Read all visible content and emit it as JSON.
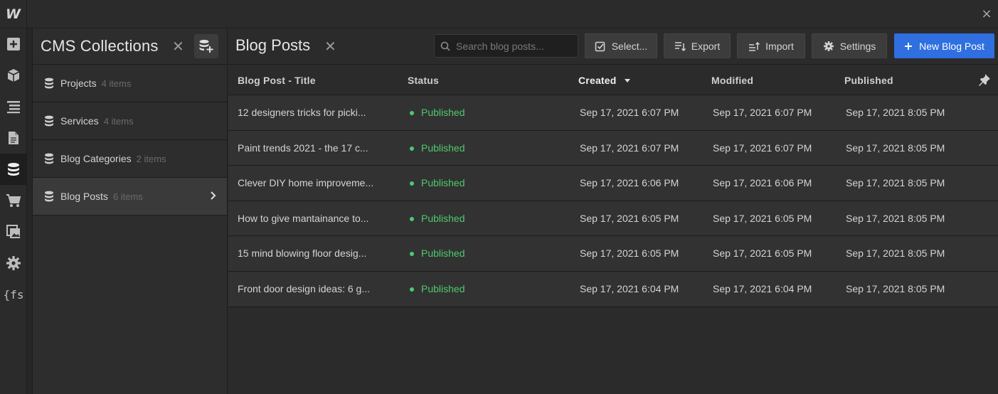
{
  "app": {
    "logo": "W",
    "close_symbol": "×"
  },
  "rail": {
    "items": [
      {
        "name": "add-panel",
        "icon": "plus-square-icon"
      },
      {
        "name": "navigator",
        "icon": "cube-icon"
      },
      {
        "name": "structure",
        "icon": "layers-icon"
      },
      {
        "name": "pages",
        "icon": "page-icon"
      },
      {
        "name": "cms",
        "icon": "database-icon",
        "active": true
      },
      {
        "name": "ecommerce",
        "icon": "cart-icon"
      },
      {
        "name": "assets",
        "icon": "images-icon"
      },
      {
        "name": "settings",
        "icon": "gear-icon"
      },
      {
        "name": "finsweet",
        "icon": "fs-icon",
        "label": "{fs"
      }
    ]
  },
  "collections": {
    "title": "CMS Collections",
    "close_symbol": "✕",
    "items": [
      {
        "name": "Projects",
        "count": "4 items"
      },
      {
        "name": "Services",
        "count": "4 items"
      },
      {
        "name": "Blog Categories",
        "count": "2 items"
      },
      {
        "name": "Blog Posts",
        "count": "6 items",
        "active": true
      }
    ]
  },
  "main": {
    "title": "Blog Posts",
    "close_symbol": "✕",
    "search": {
      "placeholder": "Search blog posts..."
    },
    "buttons": {
      "select": "Select...",
      "export": "Export",
      "import": "Import",
      "settings": "Settings",
      "new": "New Blog Post"
    },
    "columns": {
      "title": "Blog Post - Title",
      "status": "Status",
      "created": "Created",
      "modified": "Modified",
      "published": "Published"
    },
    "rows": [
      {
        "title": "12 designers tricks for picki...",
        "status": "Published",
        "created": "Sep 17, 2021 6:07 PM",
        "modified": "Sep 17, 2021 6:07 PM",
        "published": "Sep 17, 2021 8:05 PM"
      },
      {
        "title": "Paint trends 2021 - the 17 c...",
        "status": "Published",
        "created": "Sep 17, 2021 6:07 PM",
        "modified": "Sep 17, 2021 6:07 PM",
        "published": "Sep 17, 2021 8:05 PM"
      },
      {
        "title": "Clever DIY home improveme...",
        "status": "Published",
        "created": "Sep 17, 2021 6:06 PM",
        "modified": "Sep 17, 2021 6:06 PM",
        "published": "Sep 17, 2021 8:05 PM"
      },
      {
        "title": "How to give mantainance to...",
        "status": "Published",
        "created": "Sep 17, 2021 6:05 PM",
        "modified": "Sep 17, 2021 6:05 PM",
        "published": "Sep 17, 2021 8:05 PM"
      },
      {
        "title": "15 mind blowing floor desig...",
        "status": "Published",
        "created": "Sep 17, 2021 6:05 PM",
        "modified": "Sep 17, 2021 6:05 PM",
        "published": "Sep 17, 2021 8:05 PM"
      },
      {
        "title": "Front door design ideas: 6 g...",
        "status": "Published",
        "created": "Sep 17, 2021 6:04 PM",
        "modified": "Sep 17, 2021 6:04 PM",
        "published": "Sep 17, 2021 8:05 PM"
      }
    ]
  },
  "colors": {
    "accent": "#2f6fe0",
    "published": "#4ec96e",
    "background": "#2b2b2b"
  }
}
